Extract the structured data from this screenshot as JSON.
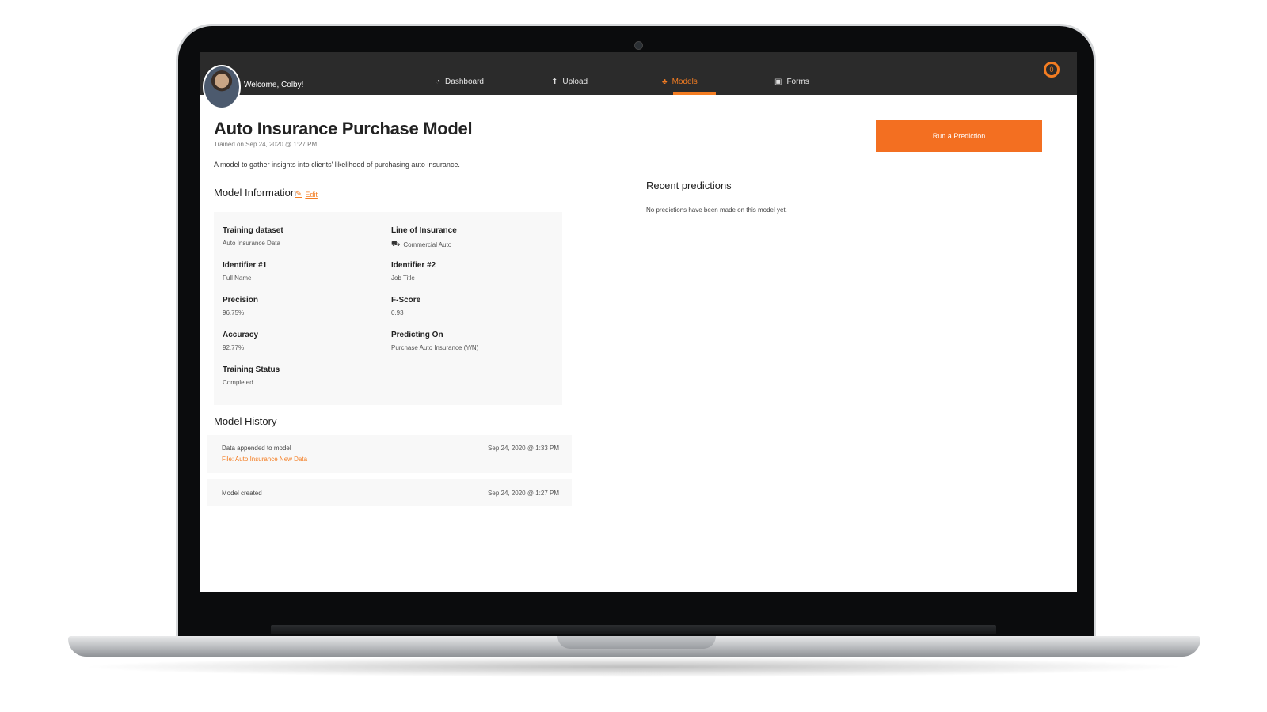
{
  "nav": {
    "welcome": "Welcome, Colby!",
    "items": [
      {
        "label": "Dashboard",
        "icon": "dashboard-icon",
        "active": false
      },
      {
        "label": "Upload",
        "icon": "upload-icon",
        "active": false
      },
      {
        "label": "Models",
        "icon": "models-icon",
        "active": true
      },
      {
        "label": "Forms",
        "icon": "forms-icon",
        "active": false
      }
    ],
    "logo_text": "0"
  },
  "model": {
    "title": "Auto Insurance Purchase Model",
    "trained": "Trained on Sep 24, 2020 @ 1:27 PM",
    "description": "A model to gather insights into clients' likelihood of purchasing auto insurance.",
    "run_button": "Run a Prediction"
  },
  "info": {
    "section_title": "Model Information",
    "edit_label": "Edit",
    "fields": [
      {
        "label": "Training dataset",
        "value": "Auto Insurance Data"
      },
      {
        "label": "Line of Insurance",
        "value": "Commercial Auto",
        "icon": "truck-icon"
      },
      {
        "label": "Identifier #1",
        "value": "Full Name"
      },
      {
        "label": "Identifier #2",
        "value": "Job Title"
      },
      {
        "label": "Precision",
        "value": "96.75%"
      },
      {
        "label": "F-Score",
        "value": "0.93"
      },
      {
        "label": "Accuracy",
        "value": "92.77%"
      },
      {
        "label": "Predicting On",
        "value": "Purchase Auto Insurance (Y/N)"
      },
      {
        "label": "Training Status",
        "value": "Completed"
      }
    ]
  },
  "recent": {
    "title": "Recent predictions",
    "empty": "No predictions have been made on this model yet."
  },
  "history": {
    "title": "Model History",
    "rows": [
      {
        "text": "Data appended to model",
        "file": "File: Auto Insurance New Data",
        "date": "Sep 24, 2020 @ 1:33 PM"
      },
      {
        "text": "Model created",
        "date": "Sep 24, 2020 @ 1:27 PM"
      }
    ]
  },
  "colors": {
    "accent": "#f47d22",
    "nav_bg": "#2b2b2b",
    "panel_bg": "#f8f8f8"
  }
}
